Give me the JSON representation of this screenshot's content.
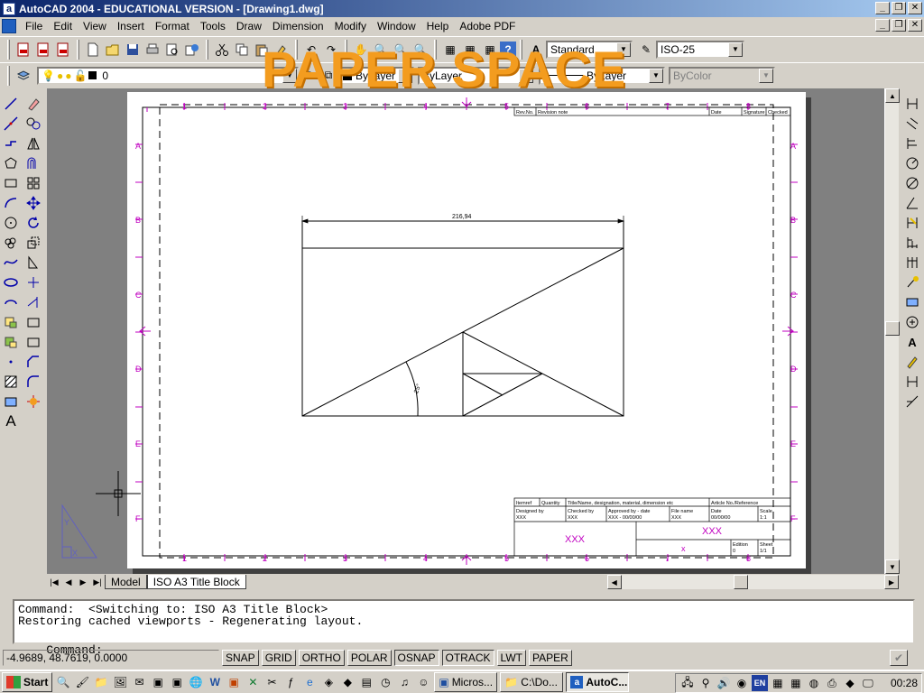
{
  "window": {
    "title": "AutoCAD 2004 - EDUCATIONAL VERSION - [Drawing1.dwg]",
    "minimize": "_",
    "restore": "❐",
    "close": "✕"
  },
  "menu": {
    "items": [
      "File",
      "Edit",
      "View",
      "Insert",
      "Format",
      "Tools",
      "Draw",
      "Dimension",
      "Modify",
      "Window",
      "Help",
      "Adobe PDF"
    ]
  },
  "toolbar": {
    "text_style": "Standard",
    "dim_style": "ISO-25",
    "layer": "0",
    "color_combo": "ByLayer",
    "linetype_combo": "ByLayer",
    "lineweight_combo": "ByLayer",
    "plotstyle_combo": "ByColor"
  },
  "overlay": {
    "text": "PAPER SPACE"
  },
  "drawing": {
    "dimension_text": "216,94",
    "angle_text": "25°",
    "grid_columns": [
      "1",
      "2",
      "3",
      "4",
      "5",
      "6",
      "7",
      "8"
    ],
    "grid_rows": [
      "A",
      "B",
      "C",
      "D",
      "E",
      "F"
    ],
    "revision_table": {
      "headers": [
        "Rev.No.",
        "Revision note",
        "Date",
        "Signature",
        "Checked"
      ]
    },
    "title_block": {
      "item_no": "Itemref",
      "quantity": "Quantity",
      "title_header": "Title/Name, designation, material, dimension etc",
      "article_no": "Article No./Reference",
      "designed_by_label": "Designed by",
      "designed_by": "XXX",
      "checked_by_label": "Checked by",
      "checked_by": "XXX",
      "approved_by_label": "Approved by - date",
      "approved_by": "XXX - 00/00/00",
      "file_name_label": "File name",
      "file_name": "XXX",
      "date_label": "Date",
      "date": "00/00/00",
      "scale_label": "Scale",
      "scale": "1:1",
      "owner": "XXX",
      "title": "XXX",
      "drawing_no": "x",
      "edition_label": "Edition",
      "edition": "0",
      "sheet_label": "Sheet",
      "sheet": "1/1"
    }
  },
  "tabs": {
    "model": "Model",
    "layout": "ISO A3 Title Block"
  },
  "command": {
    "line1": "Command:  <Switching to: ISO A3 Title Block>",
    "line2": "Restoring cached viewports - Regenerating layout.",
    "prompt": "Command:"
  },
  "status": {
    "coords": "-4.9689, 48.7619, 0.0000",
    "toggles": [
      "SNAP",
      "GRID",
      "ORTHO",
      "POLAR",
      "OSNAP",
      "OTRACK",
      "LWT",
      "PAPER"
    ]
  },
  "taskbar": {
    "start": "Start",
    "tasks": [
      "Micros...",
      "C:\\Do...",
      "AutoC..."
    ],
    "lang": "EN",
    "clock": "00:28"
  }
}
